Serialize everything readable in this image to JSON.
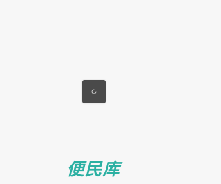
{
  "splash": {
    "background_color": "#f7f7f7",
    "loader": {
      "icon": "loading-spinner-icon",
      "box_color": "#4a4a4a",
      "spinner_color": "#cfcfcf"
    },
    "brand": {
      "name": "便民库",
      "color": "#2bb0a2"
    }
  }
}
